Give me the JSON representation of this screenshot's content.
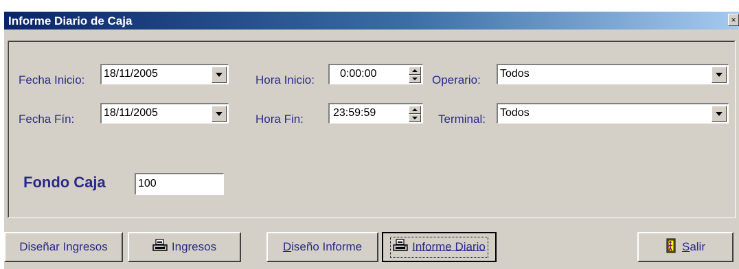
{
  "window": {
    "title": "Informe Diario de Caja",
    "close_label": "×"
  },
  "form": {
    "fecha_inicio": {
      "label": "Fecha Inicio:",
      "value": "18/11/2005"
    },
    "fecha_fin": {
      "label": "Fecha Fín:",
      "value": "18/11/2005"
    },
    "hora_inicio": {
      "label": "Hora Inicio:",
      "value": "0:00:00"
    },
    "hora_fin": {
      "label": "Hora Fin:",
      "value": "23:59:59"
    },
    "operario": {
      "label": "Operario:",
      "value": "Todos"
    },
    "terminal": {
      "label": "Terminal:",
      "value": "Todos"
    },
    "fondo_caja": {
      "label": "Fondo Caja",
      "value": "100"
    }
  },
  "buttons": {
    "disenar_ingresos": "Diseñar Ingresos",
    "ingresos": "Ingresos",
    "diseno_informe_mnemonic": "D",
    "diseno_informe_rest": "iseño Informe",
    "informe_diario": "Informe Diario",
    "salir_mnemonic": "S",
    "salir_rest": "alir"
  },
  "icons": {
    "printer": "printer-icon",
    "exit": "door-exit-icon"
  },
  "colors": {
    "label_text": "#2a2a8a",
    "title_gradient_start": "#0a246a",
    "window_face": "#d4d0c8"
  }
}
